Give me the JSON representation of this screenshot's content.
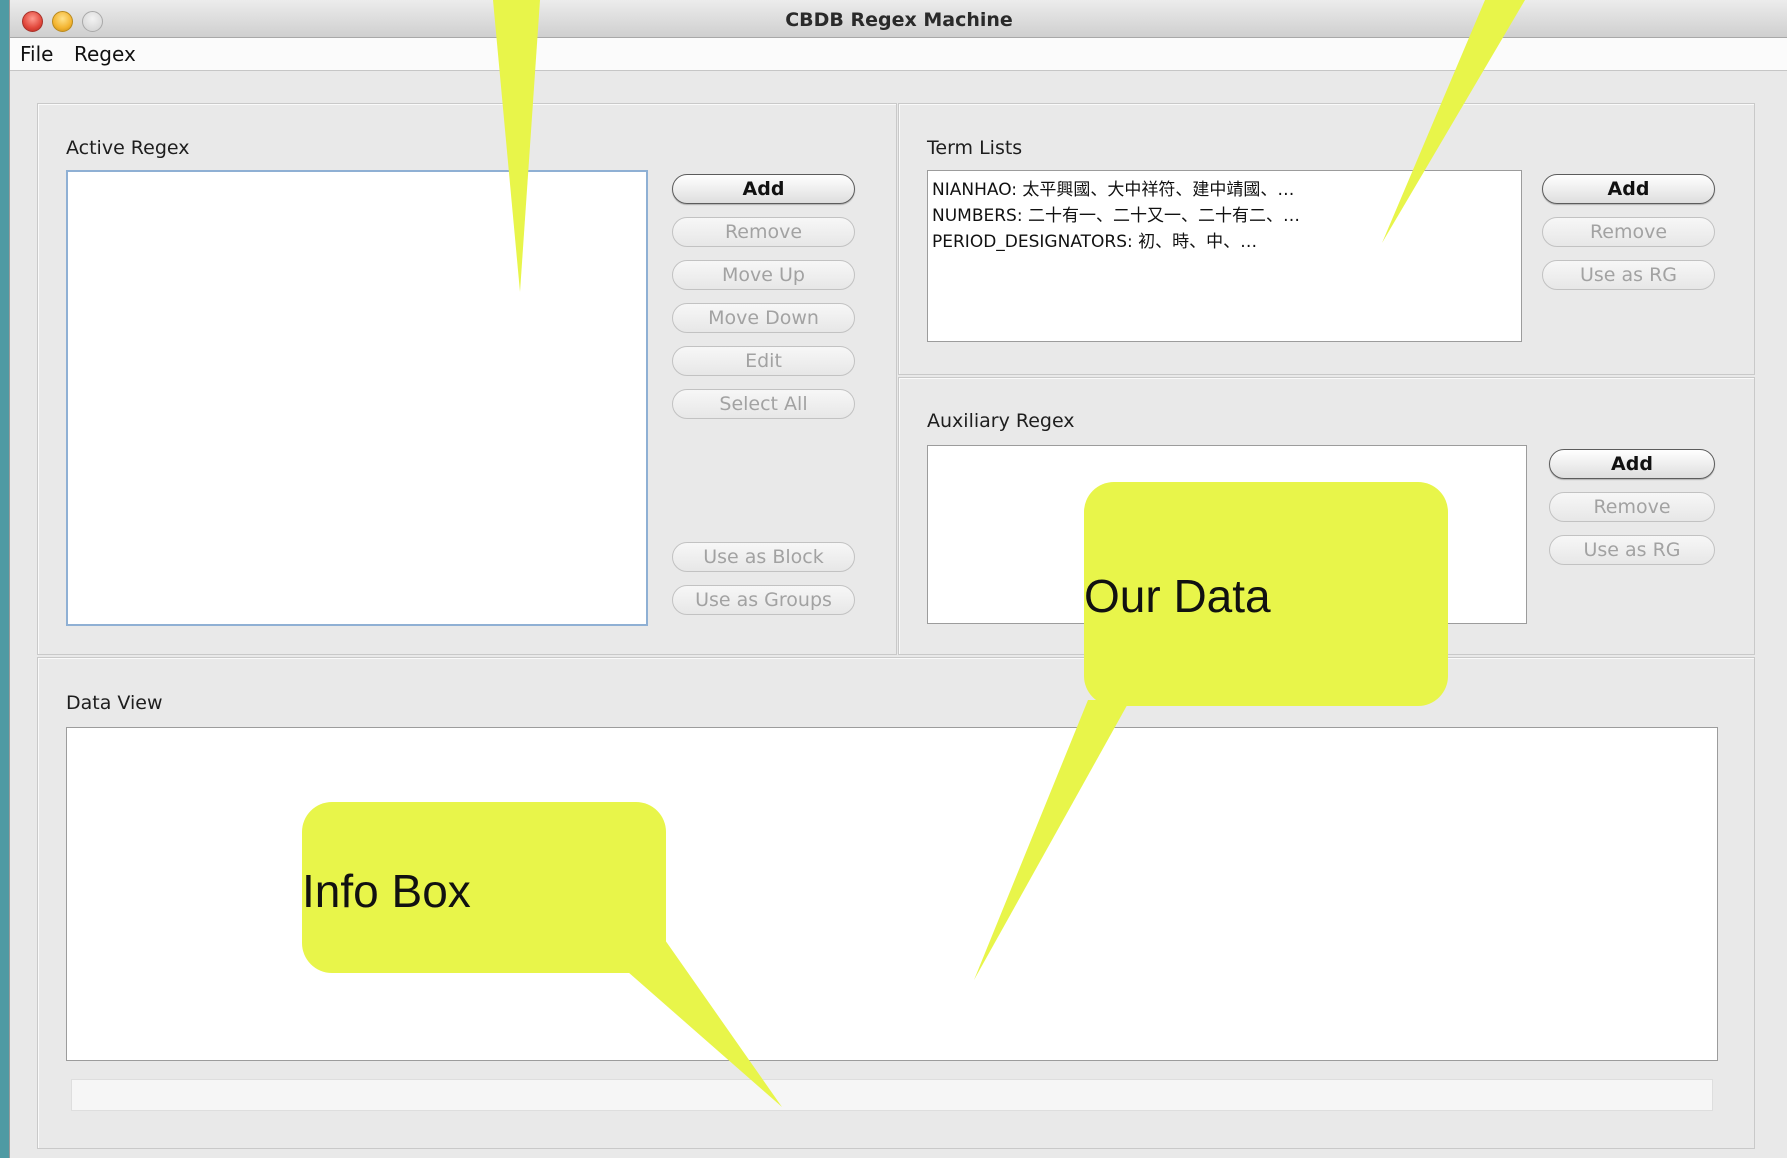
{
  "window": {
    "title": "CBDB Regex Machine",
    "menu": [
      "File",
      "Regex"
    ]
  },
  "active_regex": {
    "label": "Active Regex",
    "buttons": {
      "add": "Add",
      "remove": "Remove",
      "move_up": "Move Up",
      "move_down": "Move Down",
      "edit": "Edit",
      "select_all": "Select All",
      "use_as_block": "Use as Block",
      "use_as_groups": "Use as Groups"
    }
  },
  "term_lists": {
    "label": "Term Lists",
    "items": [
      "NIANHAO: 太平興國、大中祥符、建中靖國、…",
      "NUMBERS: 二十有一、二十又一、二十有二、…",
      "PERIOD_DESIGNATORS: 初、時、中、…"
    ],
    "buttons": {
      "add": "Add",
      "remove": "Remove",
      "use_as_rg": "Use as RG"
    }
  },
  "auxiliary_regex": {
    "label": "Auxiliary Regex",
    "buttons": {
      "add": "Add",
      "remove": "Remove",
      "use_as_rg": "Use as RG"
    }
  },
  "data_view": {
    "label": "Data View"
  },
  "callouts": {
    "our_data": "Our Data",
    "info_box": "Info Box"
  },
  "colors": {
    "callout_fill": "#e8f54a",
    "desktop": "#4f9aa3"
  }
}
